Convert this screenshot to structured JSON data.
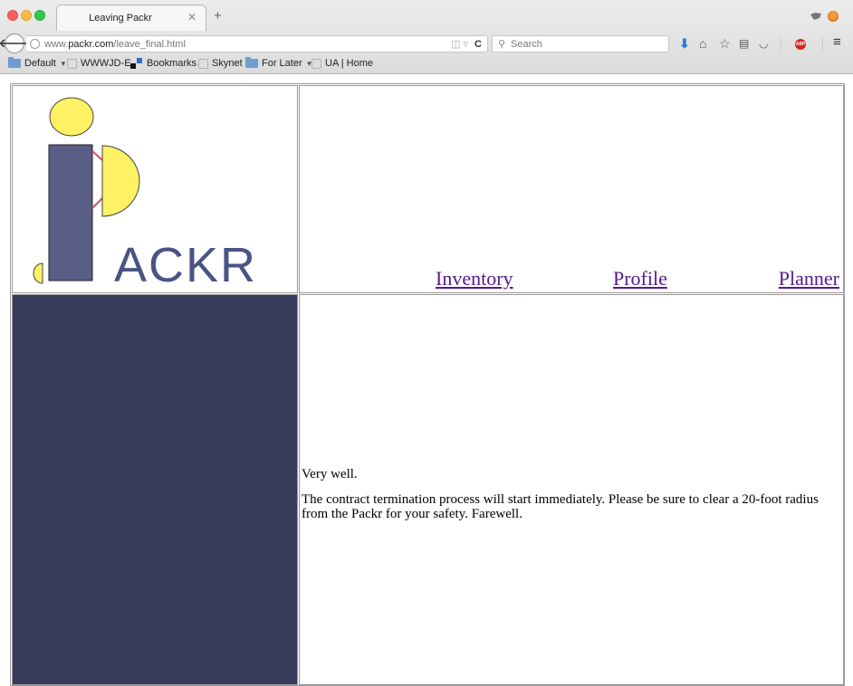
{
  "browser": {
    "tab_title": "Leaving Packr",
    "tab_close": "✕",
    "new_tab": "+",
    "url_prefix": "www.",
    "url_domain": "packr.com",
    "url_path": "/leave_final.html",
    "search_placeholder": "Search",
    "icons": [
      "back-arrow",
      "globe",
      "reload",
      "search",
      "download",
      "home",
      "star",
      "reading-list",
      "pocket",
      "adblock",
      "menu"
    ]
  },
  "bookmarks": [
    {
      "label": "Default",
      "icon": "folder",
      "dropdown": true
    },
    {
      "label": "WWWJD-E",
      "icon": "page"
    },
    {
      "label": "Bookmarks",
      "icon": "bookmarks"
    },
    {
      "label": "Skynet",
      "icon": "page"
    },
    {
      "label": "For Later",
      "icon": "folder",
      "dropdown": true
    },
    {
      "label": "UA | Home",
      "icon": "page"
    }
  ],
  "site": {
    "logo_text": "ACKR",
    "nav": {
      "inventory": "Inventory",
      "profile": "Profile",
      "planner": "Planner"
    },
    "message": {
      "line1": "Very well.",
      "line2": "The contract termination process will start immediately. Please be sure to clear a 20-foot radius from the Packr for your safety. Farewell."
    }
  },
  "colors": {
    "sidebar": "#363b5b",
    "logo_blue": "#4a5384",
    "logo_yellow": "#fef164",
    "link_visited": "#551a8b"
  }
}
